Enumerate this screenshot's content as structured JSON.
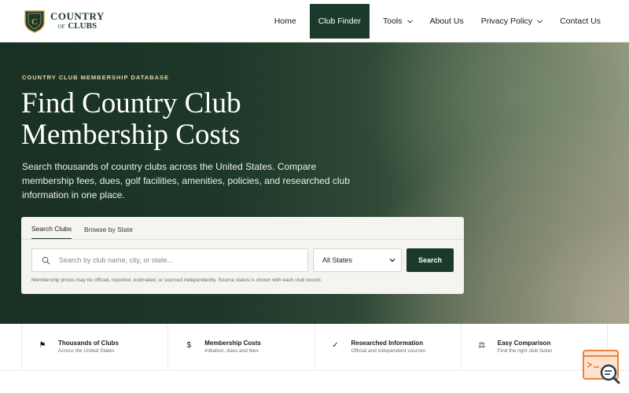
{
  "brand": {
    "line1": "COUNTRY",
    "line2_small": "OF",
    "line2": "CLUBS"
  },
  "nav": {
    "items": [
      {
        "label": "Home"
      },
      {
        "label": "Club Finder"
      },
      {
        "label": "Tools"
      },
      {
        "label": "About Us"
      },
      {
        "label": "Privacy Policy"
      },
      {
        "label": "Contact Us"
      }
    ],
    "active": "Club Finder"
  },
  "hero": {
    "eyebrow": "COUNTRY CLUB MEMBERSHIP DATABASE",
    "title": "Find Country Club Membership Costs",
    "subtitle": "Search thousands of country clubs across the United States. Compare membership fees, dues, golf facilities, amenities, policies, and researched club information in one place."
  },
  "search": {
    "tabs": [
      "Search Clubs",
      "Browse by State"
    ],
    "active_tab": "Search Clubs",
    "placeholder": "Search by club name, city, or state...",
    "value": "",
    "state_selected": "All States",
    "button_label": "Search",
    "disclaimer": "Membership prices may be official, reported, estimated, or sourced independently. Source status is shown with each club record."
  },
  "features": [
    {
      "icon": "flag-icon",
      "glyph": "⚑",
      "title": "Thousands of Clubs",
      "subtitle": "Across the United States"
    },
    {
      "icon": "dollar-icon",
      "glyph": "$",
      "title": "Membership Costs",
      "subtitle": "Initiation, dues and fees"
    },
    {
      "icon": "check-icon",
      "glyph": "✓",
      "title": "Researched Information",
      "subtitle": "Official and independent sources"
    },
    {
      "icon": "scale-icon",
      "glyph": "⚖",
      "title": "Easy Comparison",
      "subtitle": "Find the right club faster"
    }
  ],
  "colors": {
    "brand_green": "#1c3a2c",
    "eyebrow_gold": "#e6d9a8",
    "widget_orange": "#e8833a"
  }
}
